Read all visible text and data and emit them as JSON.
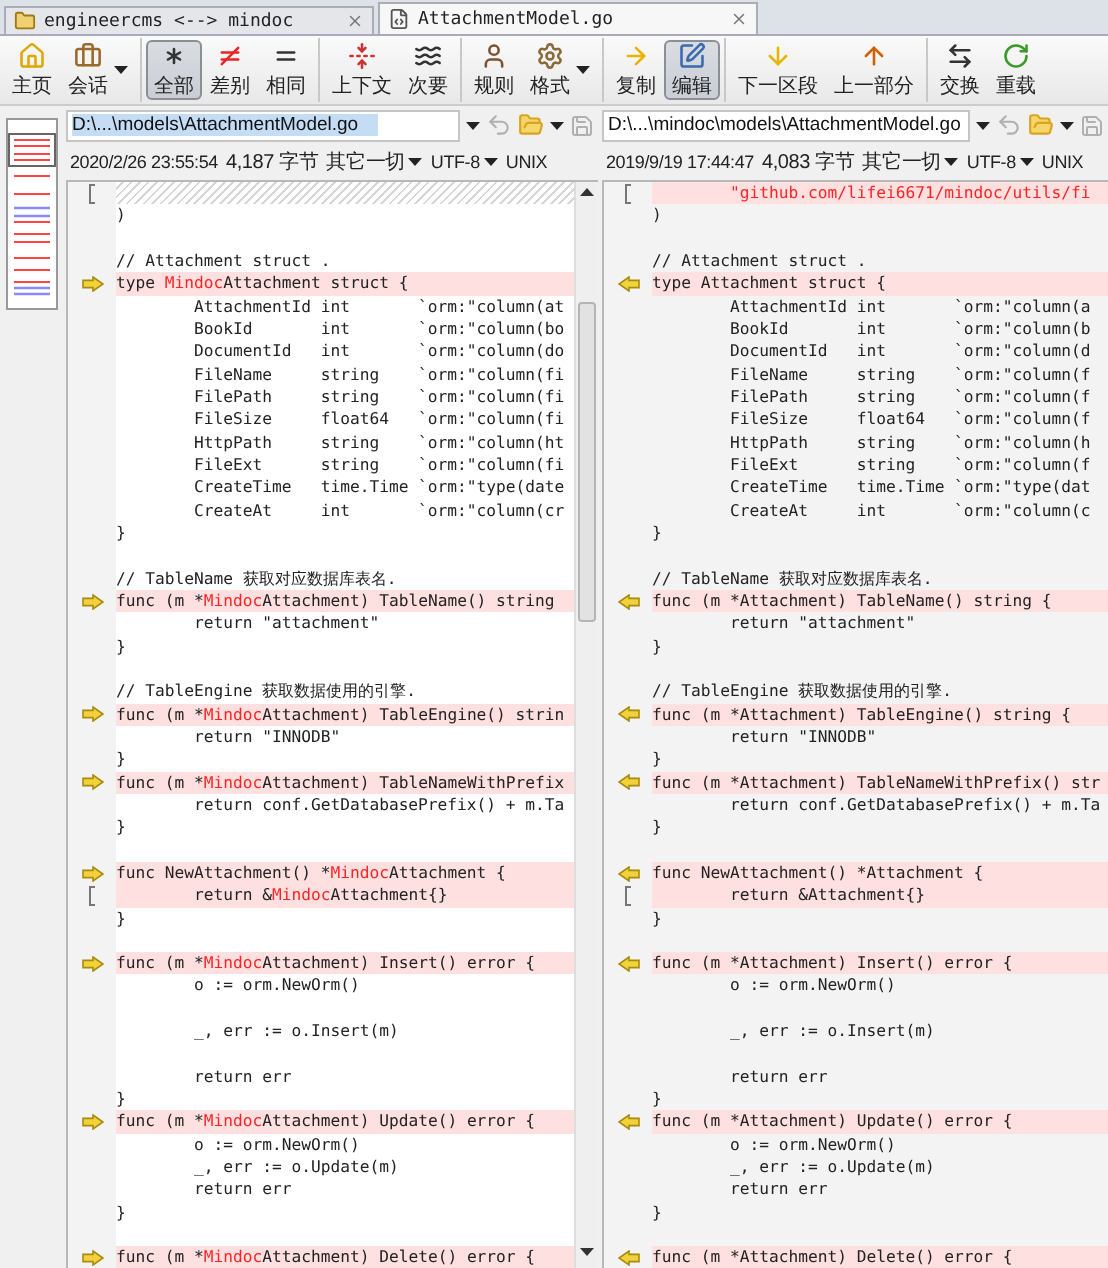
{
  "tabs": [
    {
      "label": "engineercms <--> mindoc",
      "selected": false
    },
    {
      "label": "AttachmentModel.go",
      "selected": true
    }
  ],
  "toolbar": {
    "groups": [
      [
        {
          "label": "主页",
          "selected": false,
          "menu": false
        },
        {
          "label": "会话",
          "selected": false,
          "menu": true
        }
      ],
      [
        {
          "label": "全部",
          "selected": true,
          "menu": false
        },
        {
          "label": "差别",
          "selected": false,
          "menu": false
        },
        {
          "label": "相同",
          "selected": false,
          "menu": false
        }
      ],
      [
        {
          "label": "上下文",
          "selected": false,
          "menu": false
        },
        {
          "label": "次要",
          "selected": false,
          "menu": false
        }
      ],
      [
        {
          "label": "规则",
          "selected": false,
          "menu": false
        },
        {
          "label": "格式",
          "selected": false,
          "menu": true
        }
      ],
      [
        {
          "label": "复制",
          "selected": false,
          "menu": false
        },
        {
          "label": "编辑",
          "selected": true,
          "menu": false
        }
      ],
      [
        {
          "label": "下一区段",
          "selected": false,
          "menu": false
        },
        {
          "label": "上一部分",
          "selected": false,
          "menu": false
        }
      ],
      [
        {
          "label": "交换",
          "selected": false,
          "menu": false
        },
        {
          "label": "重载",
          "selected": false,
          "menu": false
        }
      ]
    ]
  },
  "panes": [
    {
      "focused": true,
      "path": {
        "value": "D:\\...\\models\\AttachmentModel.go",
        "highlighted": true
      },
      "info": {
        "date": "2020/2/26 23:55:54",
        "size": "4,187 字节",
        "format": "其它一切",
        "encoding": "UTF-8",
        "line_ending": "UNIX"
      },
      "lines": [
        {
          "missing": true,
          "bracket": true
        },
        {
          "text": ")",
          "changed": false
        },
        {
          "changed": false
        },
        {
          "text": "// Attachment struct .",
          "changed": false
        },
        {
          "segments": [
            {
              "text": "type ",
              "changed": false
            },
            {
              "text": "Mindoc",
              "changed": true
            },
            {
              "text": "Attachment struct {",
              "changed": false
            }
          ],
          "changed": true,
          "arrow": true
        },
        {
          "text": "        AttachmentId int       `orm:\"column(at",
          "changed": false
        },
        {
          "text": "        BookId       int       `orm:\"column(bo",
          "changed": false
        },
        {
          "text": "        DocumentId   int       `orm:\"column(do",
          "changed": false
        },
        {
          "text": "        FileName     string    `orm:\"column(fi",
          "changed": false
        },
        {
          "text": "        FilePath     string    `orm:\"column(fi",
          "changed": false
        },
        {
          "text": "        FileSize     float64   `orm:\"column(fi",
          "changed": false
        },
        {
          "text": "        HttpPath     string    `orm:\"column(ht",
          "changed": false
        },
        {
          "text": "        FileExt      string    `orm:\"column(fi",
          "changed": false
        },
        {
          "text": "        CreateTime   time.Time `orm:\"type(date",
          "changed": false
        },
        {
          "text": "        CreateAt     int       `orm:\"column(cr",
          "changed": false
        },
        {
          "text": "}",
          "changed": false
        },
        {
          "changed": false
        },
        {
          "text": "// TableName 获取对应数据库表名.",
          "changed": false
        },
        {
          "segments": [
            {
              "text": "func (m *",
              "changed": false
            },
            {
              "text": "Mindoc",
              "changed": true
            },
            {
              "text": "Attachment) TableName() string",
              "changed": false
            }
          ],
          "changed": true,
          "arrow": true
        },
        {
          "text": "        return \"attachment\"",
          "changed": false
        },
        {
          "text": "}",
          "changed": false
        },
        {
          "changed": false
        },
        {
          "text": "// TableEngine 获取数据使用的引擎.",
          "changed": false
        },
        {
          "segments": [
            {
              "text": "func (m *",
              "changed": false
            },
            {
              "text": "Mindoc",
              "changed": true
            },
            {
              "text": "Attachment) TableEngine() strin",
              "changed": false
            }
          ],
          "changed": true,
          "arrow": true
        },
        {
          "text": "        return \"INNODB\"",
          "changed": false
        },
        {
          "text": "}",
          "changed": false
        },
        {
          "segments": [
            {
              "text": "func (m *",
              "changed": false
            },
            {
              "text": "Mindoc",
              "changed": true
            },
            {
              "text": "Attachment) TableNameWithPrefix",
              "changed": false
            }
          ],
          "changed": true,
          "arrow": true
        },
        {
          "text": "        return conf.GetDatabasePrefix() + m.Ta",
          "changed": false
        },
        {
          "text": "}",
          "changed": false
        },
        {
          "changed": false
        },
        {
          "segments": [
            {
              "text": "func NewAttachment() *",
              "changed": false
            },
            {
              "text": "Mindoc",
              "changed": true
            },
            {
              "text": "Attachment {",
              "changed": false
            }
          ],
          "changed": true,
          "arrow": true
        },
        {
          "segments": [
            {
              "text": "        return &",
              "changed": false
            },
            {
              "text": "Mindoc",
              "changed": true
            },
            {
              "text": "Attachment{}",
              "changed": false
            }
          ],
          "changed": true,
          "bracket": true
        },
        {
          "text": "}",
          "changed": false
        },
        {
          "changed": false
        },
        {
          "segments": [
            {
              "text": "func (m *",
              "changed": false
            },
            {
              "text": "Mindoc",
              "changed": true
            },
            {
              "text": "Attachment) Insert() error {",
              "changed": false
            }
          ],
          "changed": true,
          "arrow": true
        },
        {
          "text": "        o := orm.NewOrm()",
          "changed": false
        },
        {
          "changed": false
        },
        {
          "text": "        _, err := o.Insert(m)",
          "changed": false
        },
        {
          "changed": false
        },
        {
          "text": "        return err",
          "changed": false
        },
        {
          "text": "}",
          "changed": false
        },
        {
          "segments": [
            {
              "text": "func (m *",
              "changed": false
            },
            {
              "text": "Mindoc",
              "changed": true
            },
            {
              "text": "Attachment) Update() error {",
              "changed": false
            }
          ],
          "changed": true,
          "arrow": true
        },
        {
          "text": "        o := orm.NewOrm()",
          "changed": false
        },
        {
          "text": "        _, err := o.Update(m)",
          "changed": false
        },
        {
          "text": "        return err",
          "changed": false
        },
        {
          "text": "}",
          "changed": false
        },
        {
          "changed": false
        },
        {
          "segments": [
            {
              "text": "func (m *",
              "changed": false
            },
            {
              "text": "Mindoc",
              "changed": true
            },
            {
              "text": "Attachment) Delete() error {",
              "changed": false
            }
          ],
          "changed": true,
          "arrow": true
        }
      ]
    },
    {
      "focused": false,
      "path": {
        "value": "D:\\...\\mindoc\\models\\AttachmentModel.go",
        "highlighted": false
      },
      "info": {
        "date": "2019/9/19 17:44:47",
        "size": "4,083 字节",
        "format": "其它一切",
        "encoding": "UTF-8",
        "line_ending": "UNIX"
      },
      "lines": [
        {
          "segments": [
            {
              "text": "        \"github.com/lifei6671/mindoc/utils/fi",
              "changed": true
            }
          ],
          "changed": true,
          "bracket": true
        },
        {
          "text": ")",
          "changed": false
        },
        {
          "changed": false
        },
        {
          "text": "// Attachment struct .",
          "changed": false
        },
        {
          "text": "type Attachment struct {",
          "changed": true,
          "arrow": true
        },
        {
          "text": "        AttachmentId int       `orm:\"column(a",
          "changed": false
        },
        {
          "text": "        BookId       int       `orm:\"column(b",
          "changed": false
        },
        {
          "text": "        DocumentId   int       `orm:\"column(d",
          "changed": false
        },
        {
          "text": "        FileName     string    `orm:\"column(f",
          "changed": false
        },
        {
          "text": "        FilePath     string    `orm:\"column(f",
          "changed": false
        },
        {
          "text": "        FileSize     float64   `orm:\"column(f",
          "changed": false
        },
        {
          "text": "        HttpPath     string    `orm:\"column(h",
          "changed": false
        },
        {
          "text": "        FileExt      string    `orm:\"column(f",
          "changed": false
        },
        {
          "text": "        CreateTime   time.Time `orm:\"type(dat",
          "changed": false
        },
        {
          "text": "        CreateAt     int       `orm:\"column(c",
          "changed": false
        },
        {
          "text": "}",
          "changed": false
        },
        {
          "changed": false
        },
        {
          "text": "// TableName 获取对应数据库表名.",
          "changed": false
        },
        {
          "text": "func (m *Attachment) TableName() string {",
          "changed": true,
          "arrow": true
        },
        {
          "text": "        return \"attachment\"",
          "changed": false
        },
        {
          "text": "}",
          "changed": false
        },
        {
          "changed": false
        },
        {
          "text": "// TableEngine 获取数据使用的引擎.",
          "changed": false
        },
        {
          "text": "func (m *Attachment) TableEngine() string {",
          "changed": true,
          "arrow": true
        },
        {
          "text": "        return \"INNODB\"",
          "changed": false
        },
        {
          "text": "}",
          "changed": false
        },
        {
          "text": "func (m *Attachment) TableNameWithPrefix() str",
          "changed": true,
          "arrow": true
        },
        {
          "text": "        return conf.GetDatabasePrefix() + m.Ta",
          "changed": false
        },
        {
          "text": "}",
          "changed": false
        },
        {
          "changed": false
        },
        {
          "text": "func NewAttachment() *Attachment {",
          "changed": true,
          "arrow": true
        },
        {
          "text": "        return &Attachment{}",
          "changed": true,
          "bracket": true
        },
        {
          "text": "}",
          "changed": false
        },
        {
          "changed": false
        },
        {
          "text": "func (m *Attachment) Insert() error {",
          "changed": true,
          "arrow": true
        },
        {
          "text": "        o := orm.NewOrm()",
          "changed": false
        },
        {
          "changed": false
        },
        {
          "text": "        _, err := o.Insert(m)",
          "changed": false
        },
        {
          "changed": false
        },
        {
          "text": "        return err",
          "changed": false
        },
        {
          "text": "}",
          "changed": false
        },
        {
          "text": "func (m *Attachment) Update() error {",
          "changed": true,
          "arrow": true
        },
        {
          "text": "        o := orm.NewOrm()",
          "changed": false
        },
        {
          "text": "        _, err := o.Update(m)",
          "changed": false
        },
        {
          "text": "        return err",
          "changed": false
        },
        {
          "text": "}",
          "changed": false
        },
        {
          "changed": false
        },
        {
          "text": "func (m *Attachment) Delete() error {",
          "changed": true,
          "arrow": true
        }
      ]
    }
  ]
}
